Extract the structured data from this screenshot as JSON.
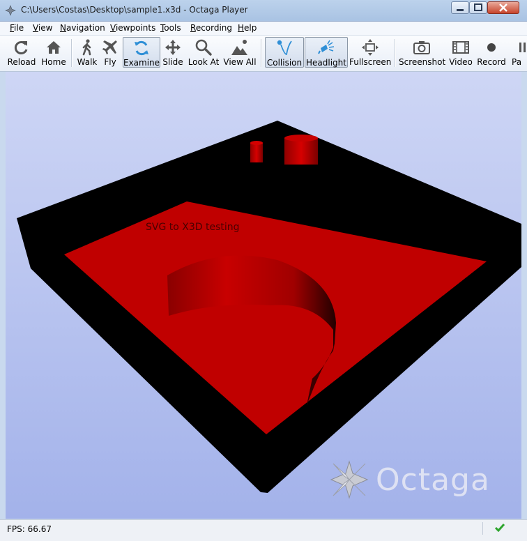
{
  "window": {
    "title": "C:\\Users\\Costas\\Desktop\\sample1.x3d - Octaga Player"
  },
  "menu": {
    "items": [
      {
        "first": "F",
        "rest": "ile"
      },
      {
        "first": "V",
        "rest": "iew"
      },
      {
        "first": "N",
        "rest": "avigation"
      },
      {
        "first": "V",
        "rest": "iewpoints"
      },
      {
        "first": "T",
        "rest": "ools"
      },
      {
        "first": "R",
        "rest": "ecording"
      },
      {
        "first": "H",
        "rest": "elp"
      }
    ]
  },
  "toolbar": {
    "buttons": [
      {
        "label": "Reload",
        "icon": "reload-icon"
      },
      {
        "label": "Home",
        "icon": "home-icon"
      },
      {
        "label": "Walk",
        "icon": "walk-icon"
      },
      {
        "label": "Fly",
        "icon": "airplane-icon"
      },
      {
        "label": "Examine",
        "icon": "examine-icon",
        "active": true
      },
      {
        "label": "Slide",
        "icon": "move-arrows-icon"
      },
      {
        "label": "Look At",
        "icon": "magnifier-icon"
      },
      {
        "label": "View All",
        "icon": "view-all-icon"
      },
      {
        "label": "Collision",
        "icon": "collision-icon",
        "active": true
      },
      {
        "label": "Headlight",
        "icon": "headlight-icon",
        "active": true
      },
      {
        "label": "Fullscreen",
        "icon": "fullscreen-icon"
      },
      {
        "label": "Screenshot",
        "icon": "camera-icon"
      },
      {
        "label": "Video",
        "icon": "film-icon"
      },
      {
        "label": "Record",
        "icon": "record-icon"
      },
      {
        "label": "Pa",
        "icon": "pause-icon"
      }
    ]
  },
  "viewport": {
    "scene_text": "SVG to X3D testing",
    "logo_text": "Octaga",
    "colors": {
      "base": "#000000",
      "top_face": "#c00000",
      "sky_top": "#ced6f5",
      "sky_bottom": "#a3b2ea"
    }
  },
  "status": {
    "fps": "FPS: 66.67",
    "ok_icon": "checkmark-icon",
    "ok_color": "#2ea52e"
  }
}
